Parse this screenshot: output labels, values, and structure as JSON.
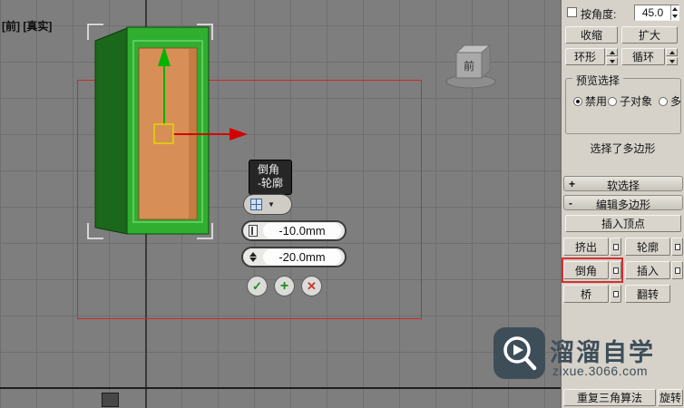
{
  "colors": {
    "viewport_bg": "#7e7e7e",
    "panel_bg": "#d6d2ca",
    "object_green": "#2fae2f",
    "object_face_orange": "#d88f57",
    "gizmo_y_green": "#00b400",
    "gizmo_x_red": "#d40000",
    "highlight_red": "#d43030",
    "watermark_slate": "#3e4e59"
  },
  "viewport": {
    "label": "[前] [真实]",
    "viewcube_face": "前",
    "caddy": {
      "tooltip_title": "倒角",
      "tooltip_sub": "-轮廓",
      "field1_value": "-10.0mm",
      "field2_value": "-20.0mm"
    }
  },
  "icons": {
    "dropdown_arrow": "▼",
    "apply": "✓",
    "add": "+",
    "cancel": "✕"
  },
  "panel": {
    "by_angle_label": "按角度:",
    "by_angle_value": "45.0",
    "shrink_label": "收缩",
    "grow_label": "扩大",
    "ring_label": "环形",
    "loop_label": "循环",
    "preview_group_title": "预览选择",
    "radio_disable": "禁用",
    "radio_subobject": "子对象",
    "radio_multiple": "多个",
    "status_text": "选择了多边形",
    "soft_selection": {
      "toggle": "+",
      "title": "软选择"
    },
    "edit_polygons": {
      "toggle": "-",
      "title": "编辑多边形"
    },
    "insert_vertex_label": "插入顶点",
    "extrude_label": "挤出",
    "outline_label": "轮廓",
    "bevel_label": "倒角",
    "inset_label": "插入",
    "bridge_label": "桥",
    "flip_label": "翻转",
    "retriangulate_label": "重复三角算法",
    "rotate_label": "旋转"
  },
  "watermark": {
    "title": "溜溜自学",
    "url": "zixue.3066.com"
  }
}
